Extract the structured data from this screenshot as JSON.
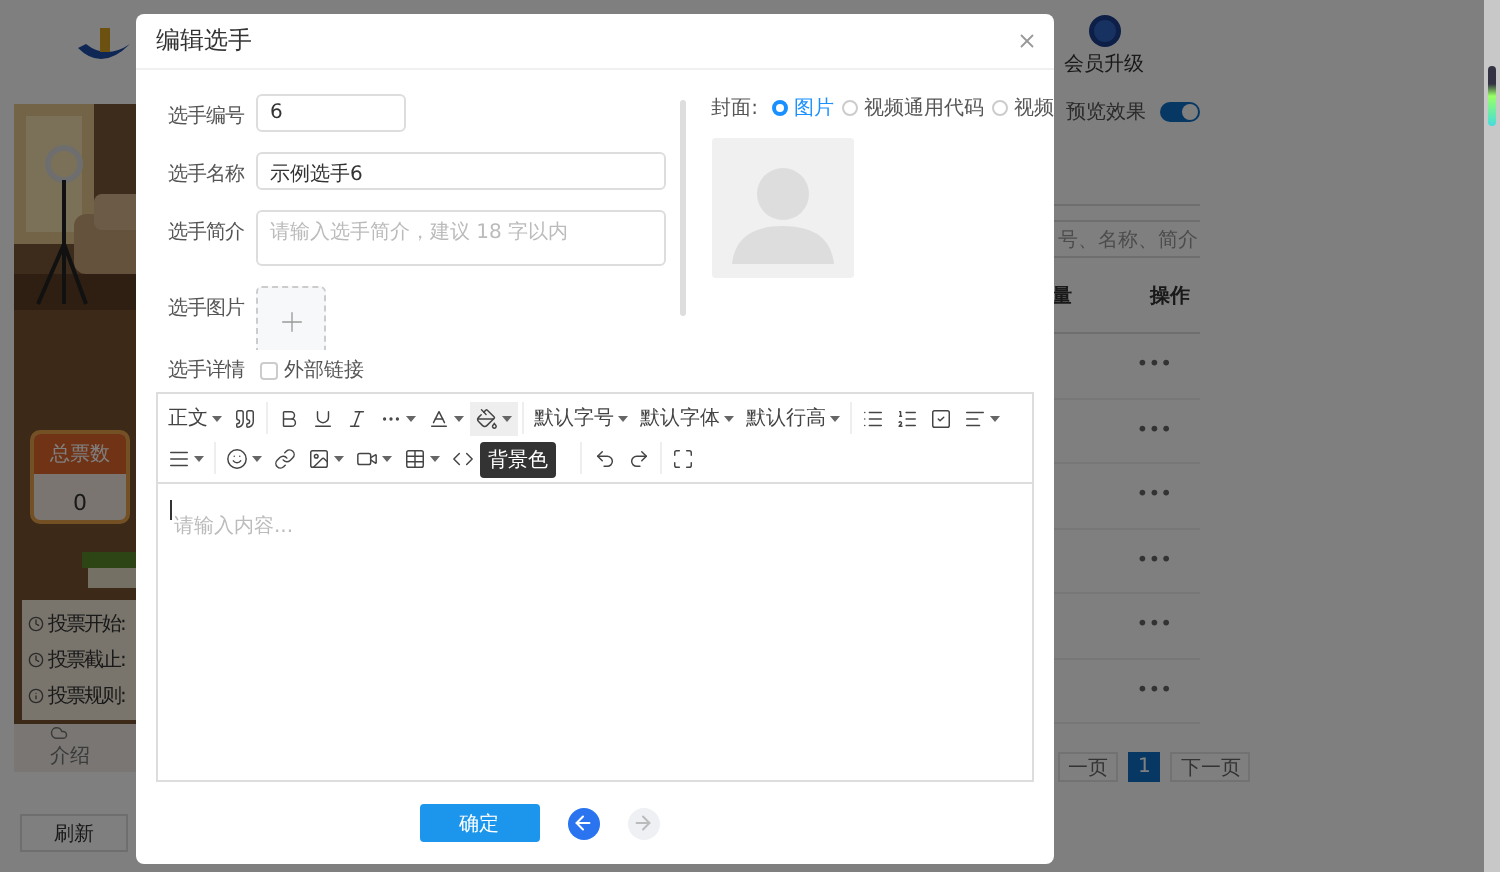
{
  "background": {
    "header": {
      "vip_label": "会员升级"
    },
    "preview": {
      "stat_label": "总票数",
      "stat_value": "0",
      "rules": [
        "投票开始:",
        "投票截止:",
        "投票规则:"
      ],
      "tab_label": "介绍"
    },
    "refresh_button": "刷新",
    "preview_toggle": {
      "label": "预览效果",
      "on": true
    },
    "search": {
      "placeholder": "号、名称、简介"
    },
    "table": {
      "columns": [
        "量",
        "操作"
      ],
      "rows": [
        {
          "action": "•••"
        },
        {
          "action": "•••"
        },
        {
          "action": "•••"
        },
        {
          "action": "•••"
        },
        {
          "action": "•••"
        },
        {
          "action": "•••"
        }
      ]
    },
    "pagination": {
      "prev": "一页",
      "pages": [
        {
          "label": "1",
          "selected": true
        }
      ],
      "next": "下一页"
    }
  },
  "dialog": {
    "title": "编辑选手",
    "fields": [
      {
        "kind": "short",
        "label": "选手编号",
        "value": "6"
      },
      {
        "kind": "input",
        "label": "选手名称",
        "value": "示例选手6"
      },
      {
        "kind": "textarea",
        "label": "选手简介",
        "placeholder": "请输入选手简介，建议 18 字以内"
      },
      {
        "kind": "upload",
        "label": "选手图片"
      }
    ],
    "detail": {
      "label": "选手详情",
      "option": "外部链接",
      "checked": false
    },
    "cover": {
      "label": "封面:",
      "options": [
        {
          "label": "图片",
          "selected": true
        },
        {
          "label": "视频通用代码",
          "selected": false
        },
        {
          "label": "视频",
          "selected": false
        }
      ]
    },
    "editor": {
      "selects": [
        "正文",
        "默认字号",
        "默认字体",
        "默认行高"
      ],
      "tooltip": "背景色",
      "placeholder": "请输入内容..."
    },
    "confirm_button": "确定",
    "nav": [
      {
        "kind": "back",
        "disabled": false
      },
      {
        "kind": "forward",
        "disabled": true
      }
    ]
  }
}
